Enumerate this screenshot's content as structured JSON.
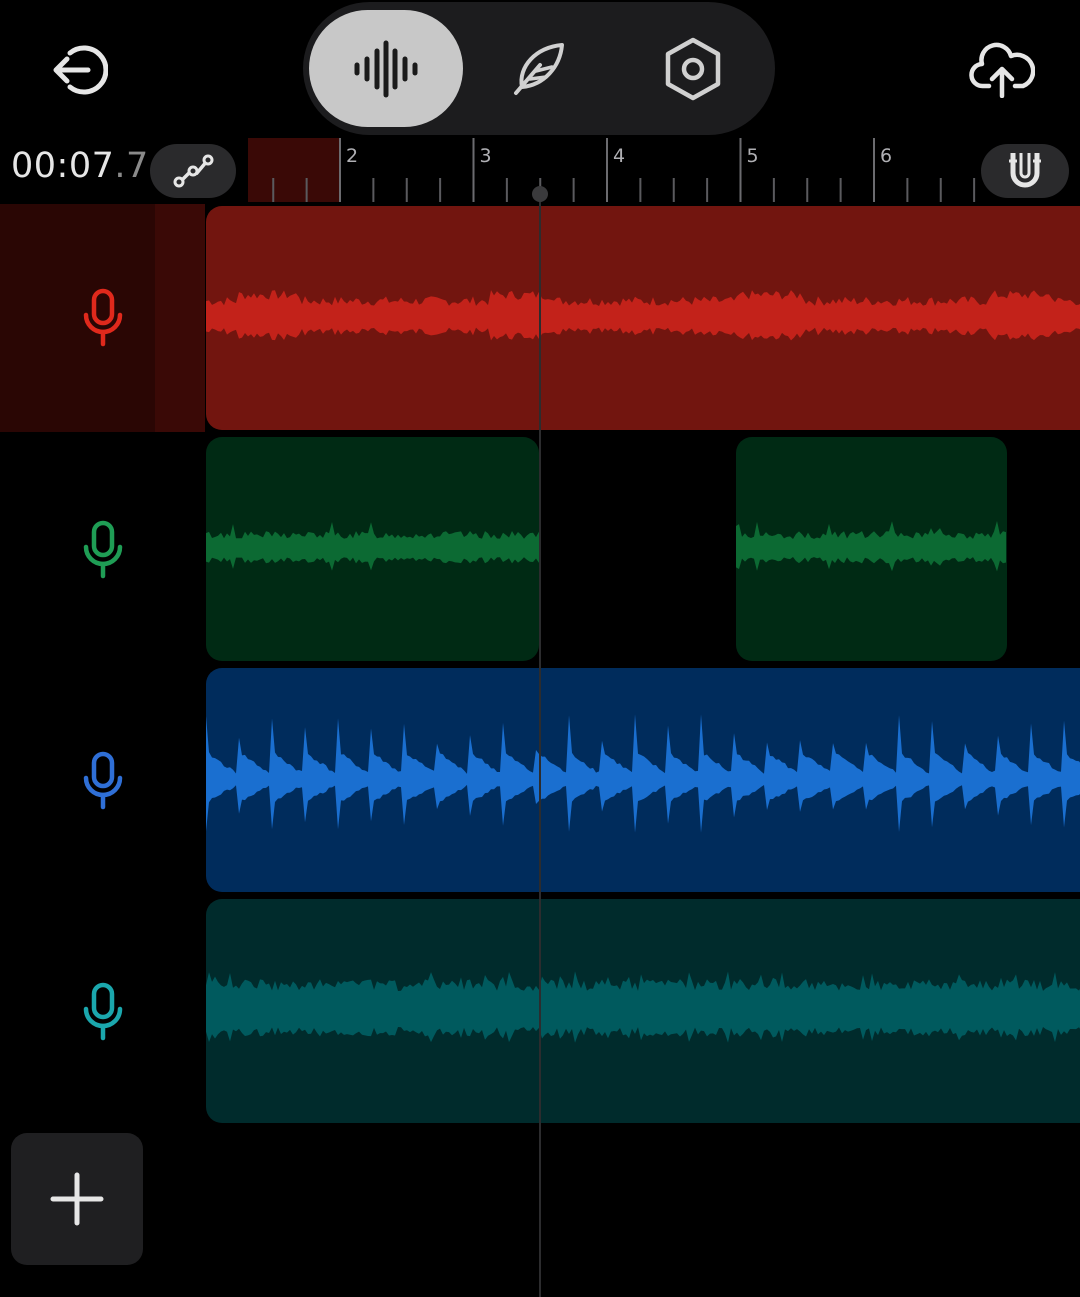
{
  "header": {
    "back_icon": "exit-arrow-icon",
    "upload_icon": "cloud-upload-icon",
    "modes": [
      {
        "icon": "waveform-icon",
        "active": true
      },
      {
        "icon": "feather-icon",
        "active": false
      },
      {
        "icon": "hexagon-settings-icon",
        "active": false
      }
    ]
  },
  "timeline": {
    "time_main": "00:07",
    "time_fraction": ".7",
    "ruler_labels": [
      "2",
      "3",
      "4",
      "5",
      "6"
    ],
    "curve_icon": "automation-curve-icon",
    "magnet_icon": "magnet-snap-icon"
  },
  "tracks": [
    {
      "icon": "microphone-icon",
      "color": "#e0291c",
      "clip_bg": "#72150f",
      "wave": "#c3221a",
      "selected": true
    },
    {
      "icon": "microphone-icon",
      "color": "#1f9d55",
      "clip_bg": "#002a14",
      "wave": "#0c6a33",
      "selected": false
    },
    {
      "icon": "microphone-icon",
      "color": "#2f6fd6",
      "clip_bg": "#002c5c",
      "wave": "#1a6fd0",
      "selected": false
    },
    {
      "icon": "microphone-icon",
      "color": "#1ba7ad",
      "clip_bg": "#002b2c",
      "wave": "#005a5e",
      "selected": false
    }
  ],
  "add_track_icon": "plus-icon"
}
